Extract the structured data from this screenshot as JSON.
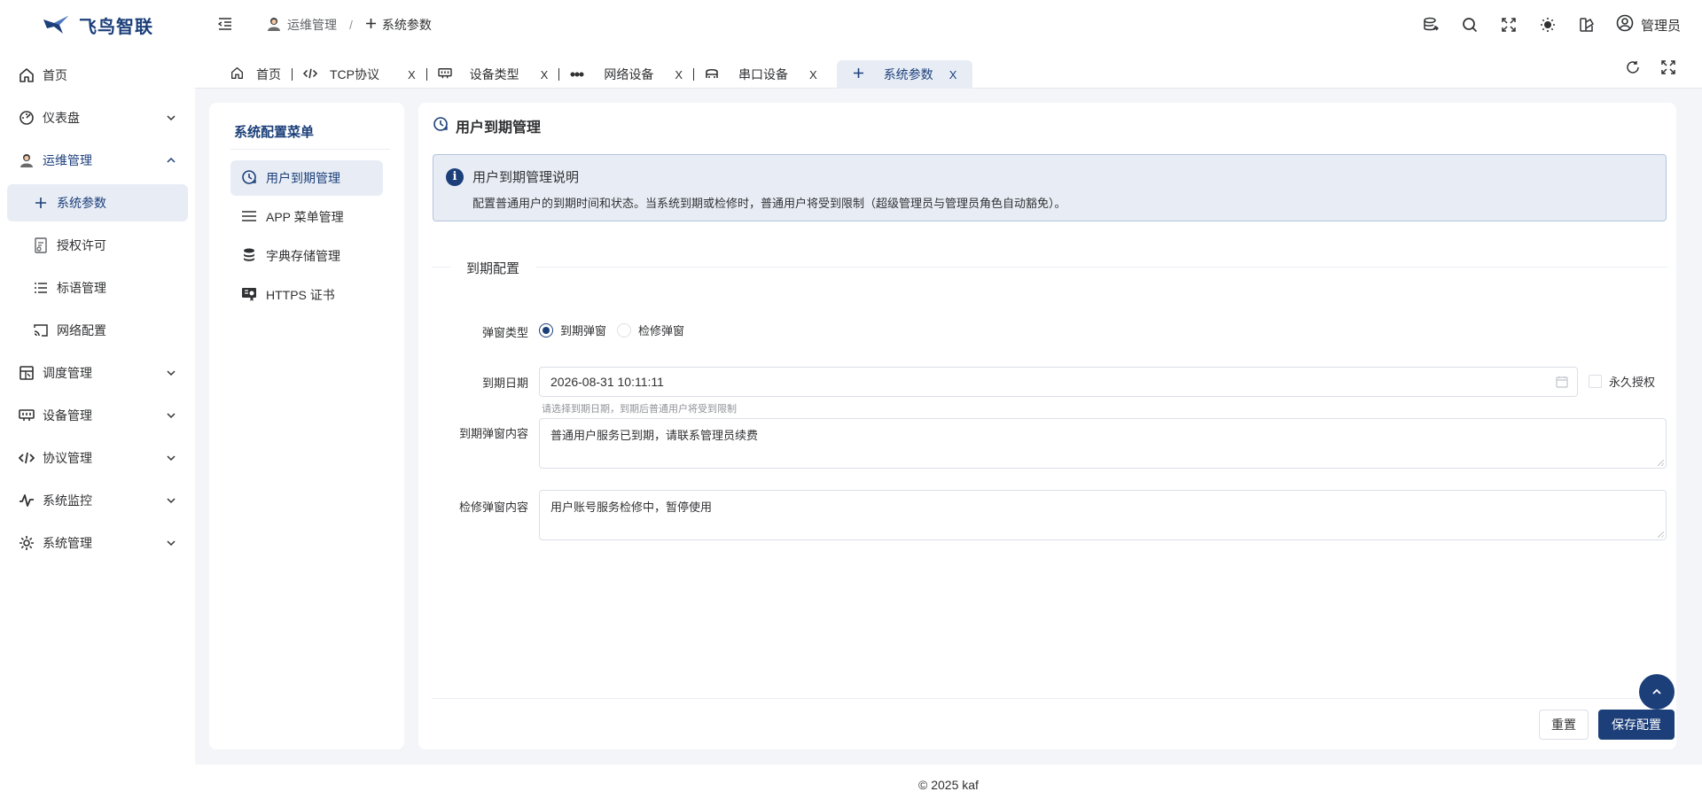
{
  "app": {
    "logo_text": "飞鸟智联"
  },
  "sidebar": {
    "items": [
      {
        "label": "首页",
        "icon": "home-icon"
      },
      {
        "label": "仪表盘",
        "icon": "dashboard-icon"
      },
      {
        "label": "运维管理",
        "icon": "operator-avatar-icon"
      },
      {
        "label": "系统参数",
        "icon": "plus-icon"
      },
      {
        "label": "授权许可",
        "icon": "license-icon"
      },
      {
        "label": "标语管理",
        "icon": "list-icon"
      },
      {
        "label": "网络配置",
        "icon": "cast-icon"
      },
      {
        "label": "调度管理",
        "icon": "schedule-icon"
      },
      {
        "label": "设备管理",
        "icon": "device-icon"
      },
      {
        "label": "协议管理",
        "icon": "code-icon"
      },
      {
        "label": "系统监控",
        "icon": "pulse-icon"
      },
      {
        "label": "系统管理",
        "icon": "gear-icon"
      }
    ]
  },
  "header": {
    "breadcrumb": [
      "运维管理",
      "系统参数"
    ],
    "separator": "/",
    "user": "管理员"
  },
  "tabs": [
    {
      "label": "首页",
      "icon": "home-icon"
    },
    {
      "label": "TCP协议",
      "icon": "code-icon"
    },
    {
      "label": "设备类型",
      "icon": "device-type-icon"
    },
    {
      "label": "网络设备",
      "icon": "network-device-icon"
    },
    {
      "label": "串口设备",
      "icon": "serial-device-icon"
    },
    {
      "label": "系统参数",
      "icon": "plus-icon"
    }
  ],
  "tab_close": "X",
  "config_menu": {
    "title": "系统配置菜单",
    "items": [
      "用户到期管理",
      "APP 菜单管理",
      "字典存储管理",
      "HTTPS 证书"
    ]
  },
  "main": {
    "title": "用户到期管理",
    "info_title": "用户到期管理说明",
    "info_icon": "i",
    "info_desc": "配置普通用户的到期时间和状态。当系统到期或检修时，普通用户将受到限制（超级管理员与管理员角色自动豁免）。",
    "section": "到期配置",
    "popup_type_label": "弹窗类型",
    "popup_options": [
      "到期弹窗",
      "检修弹窗"
    ],
    "selected_popup": "到期弹窗",
    "date_label": "到期日期",
    "date_value": "2026-08-31 10:11:11",
    "permanent_label": "永久授权",
    "permanent_checked": false,
    "date_hint": "请选择到期日期，到期后普通用户将受到限制",
    "expire_content_label": "到期弹窗内容",
    "expire_content": "普通用户服务已到期，请联系管理员续费",
    "maint_content_label": "检修弹窗内容",
    "maint_content": "用户账号服务检修中，暂停使用",
    "reset_button": "重置",
    "save_button": "保存配置"
  },
  "footer": {
    "copyright": "© 2025 kaf"
  },
  "colors": {
    "primary": "#1c3f7a",
    "active_bg": "#e8edf5"
  }
}
